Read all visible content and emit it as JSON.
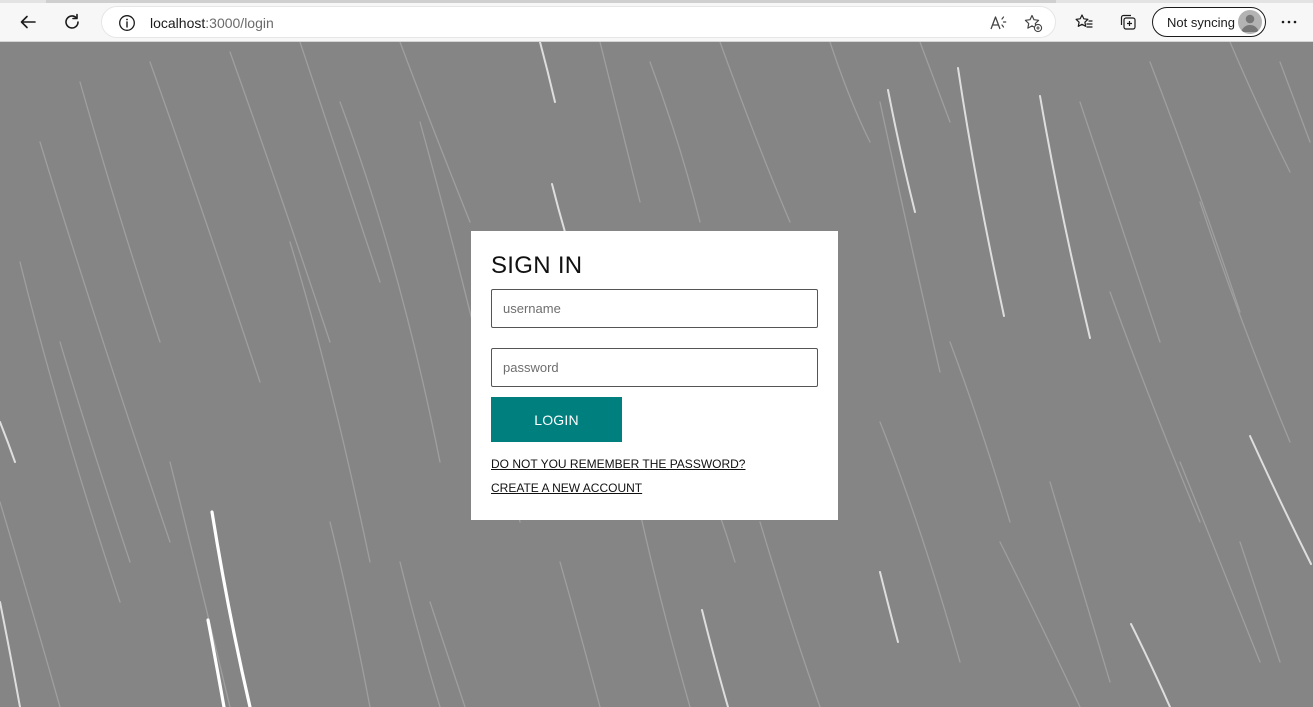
{
  "browser": {
    "url_host": "localhost",
    "url_path": ":3000/login",
    "sync_label": "Not syncing",
    "icons": {
      "back": "arrow-left-icon",
      "refresh": "refresh-icon",
      "info": "info-icon",
      "read_aloud": "read-aloud-icon",
      "add_favorite": "add-favorite-icon",
      "favorites": "favorites-icon",
      "collections": "collections-icon",
      "avatar": "avatar-icon",
      "more": "more-icon"
    }
  },
  "login": {
    "title": "SIGN IN",
    "username_placeholder": "username",
    "password_placeholder": "password",
    "login_label": "LOGIN",
    "forgot_link": "DO NOT YOU REMEMBER THE PASSWORD?",
    "create_link": "CREATE A NEW ACCOUNT"
  },
  "colors": {
    "background": "#858585",
    "card": "#ffffff",
    "button": "#007f7f",
    "button_text": "#ffffff"
  }
}
